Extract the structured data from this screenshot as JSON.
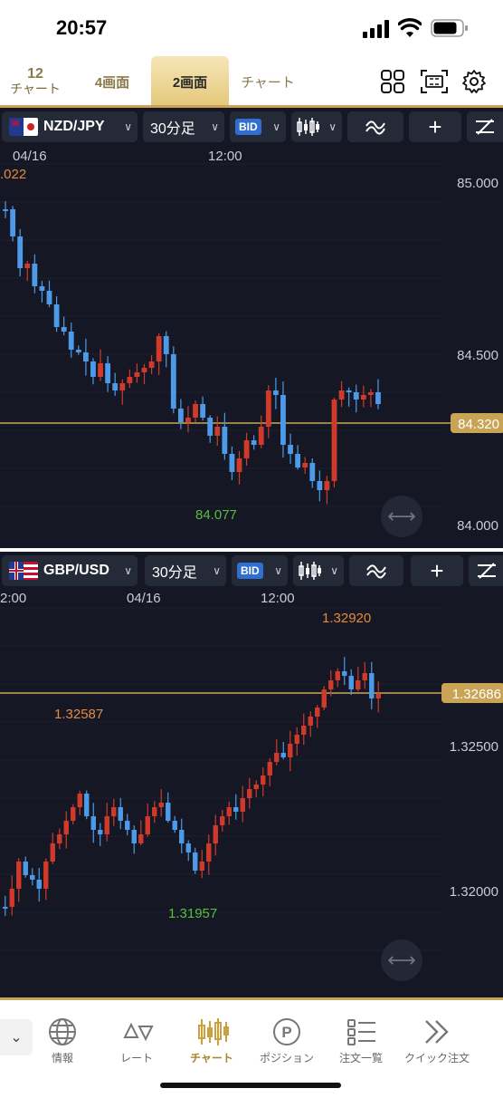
{
  "status_bar": {
    "time": "20:57"
  },
  "tabs": [
    {
      "top": "12",
      "bottom": "チャート"
    },
    {
      "label": "4画面"
    },
    {
      "label": "2画面"
    },
    {
      "label": "チャート"
    }
  ],
  "header_icons": [
    "grid-icon",
    "fullscreen-icon",
    "gear-icon"
  ],
  "charts": [
    {
      "symbol": "NZD/JPY",
      "flag": "nz-jp-flag-icon",
      "timeframe": "30分足",
      "price_type": "BID",
      "axis_prices": [
        "85.000",
        "84.500",
        "84.000"
      ],
      "time_labels": [
        "04/16",
        "12:00"
      ],
      "high_label": ".022",
      "low_label": "84.077",
      "current_price": "84.320"
    },
    {
      "symbol": "GBP/USD",
      "flag": "uk-us-flag-icon",
      "timeframe": "30分足",
      "price_type": "BID",
      "axis_prices": [
        "1.32500",
        "1.32000"
      ],
      "time_labels": [
        "2:00",
        "04/16",
        "12:00"
      ],
      "high_label": "1.32920",
      "mid_high_label": "1.32587",
      "low_label": "1.31957",
      "current_price": "1.32686"
    }
  ],
  "bottom_nav": [
    {
      "label": "情報",
      "icon": "globe-icon"
    },
    {
      "label": "レート",
      "icon": "rate-arrows-icon"
    },
    {
      "label": "チャート",
      "icon": "candlestick-icon",
      "active": true
    },
    {
      "label": "ポジション",
      "icon": "position-p-icon"
    },
    {
      "label": "注文一覧",
      "icon": "order-list-icon"
    },
    {
      "label": "クイック注文",
      "icon": "double-chevron-icon"
    }
  ],
  "colors": {
    "up": "#cf3a2a",
    "down": "#4d9ae8",
    "accent": "#c9a455",
    "background": "#151824"
  }
}
